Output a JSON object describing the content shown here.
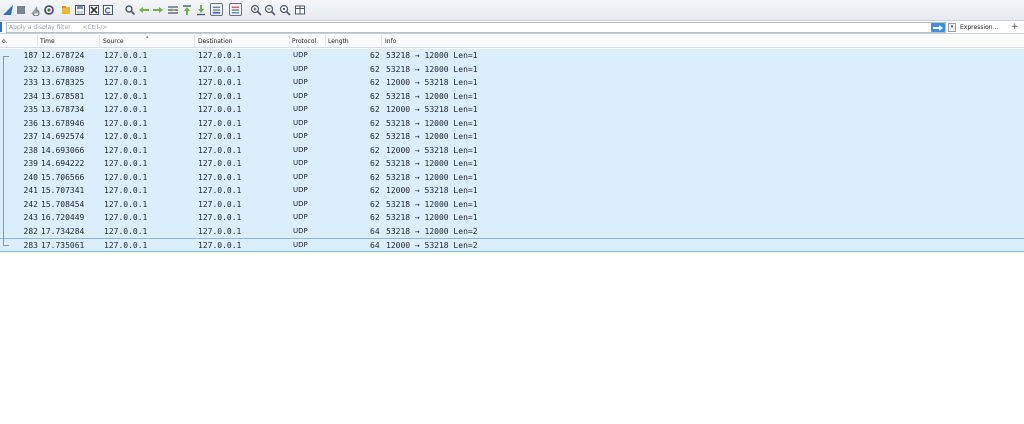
{
  "toolbar": {
    "icons": [
      "shark-fin-start-icon",
      "stop-capture-icon",
      "restart-capture-icon",
      "capture-options-icon",
      "open-file-icon",
      "save-file-icon",
      "close-file-icon",
      "reload-file-icon",
      "find-packet-icon",
      "go-back-icon",
      "go-forward-icon",
      "go-to-packet-icon",
      "go-first-packet-icon",
      "go-last-packet-icon",
      "auto-scroll-icon",
      "colorize-icon",
      "zoom-in-icon",
      "zoom-out-icon",
      "normal-size-icon",
      "resize-columns-icon"
    ],
    "colors": {
      "accent": "#3b6fb6",
      "icon": "#4d5866"
    }
  },
  "filter": {
    "placeholder": "Apply a display filter",
    "shortcut_hint": "<Ctrl-/>",
    "expression_label": "Expression...",
    "add_label": "+",
    "dropdown_label": "▾"
  },
  "columns": {
    "no": "o.",
    "time": "Time",
    "source": "Source",
    "destination": "Destination",
    "protocol": "Protocol",
    "length": "Length",
    "info": "Info"
  },
  "packets": [
    {
      "no": "187",
      "time": "12.678724",
      "src": "127.0.0.1",
      "dst": "127.0.0.1",
      "proto": "UDP",
      "len": "62",
      "info": "53218 → 12000 Len=1"
    },
    {
      "no": "232",
      "time": "13.678089",
      "src": "127.0.0.1",
      "dst": "127.0.0.1",
      "proto": "UDP",
      "len": "62",
      "info": "53218 → 12000 Len=1"
    },
    {
      "no": "233",
      "time": "13.678325",
      "src": "127.0.0.1",
      "dst": "127.0.0.1",
      "proto": "UDP",
      "len": "62",
      "info": "12000 → 53218 Len=1"
    },
    {
      "no": "234",
      "time": "13.678581",
      "src": "127.0.0.1",
      "dst": "127.0.0.1",
      "proto": "UDP",
      "len": "62",
      "info": "53218 → 12000 Len=1"
    },
    {
      "no": "235",
      "time": "13.678734",
      "src": "127.0.0.1",
      "dst": "127.0.0.1",
      "proto": "UDP",
      "len": "62",
      "info": "12000 → 53218 Len=1"
    },
    {
      "no": "236",
      "time": "13.678946",
      "src": "127.0.0.1",
      "dst": "127.0.0.1",
      "proto": "UDP",
      "len": "62",
      "info": "53218 → 12000 Len=1"
    },
    {
      "no": "237",
      "time": "14.692574",
      "src": "127.0.0.1",
      "dst": "127.0.0.1",
      "proto": "UDP",
      "len": "62",
      "info": "53218 → 12000 Len=1"
    },
    {
      "no": "238",
      "time": "14.693066",
      "src": "127.0.0.1",
      "dst": "127.0.0.1",
      "proto": "UDP",
      "len": "62",
      "info": "12000 → 53218 Len=1"
    },
    {
      "no": "239",
      "time": "14.694222",
      "src": "127.0.0.1",
      "dst": "127.0.0.1",
      "proto": "UDP",
      "len": "62",
      "info": "53218 → 12000 Len=1"
    },
    {
      "no": "240",
      "time": "15.706566",
      "src": "127.0.0.1",
      "dst": "127.0.0.1",
      "proto": "UDP",
      "len": "62",
      "info": "53218 → 12000 Len=1"
    },
    {
      "no": "241",
      "time": "15.707341",
      "src": "127.0.0.1",
      "dst": "127.0.0.1",
      "proto": "UDP",
      "len": "62",
      "info": "12000 → 53218 Len=1"
    },
    {
      "no": "242",
      "time": "15.708454",
      "src": "127.0.0.1",
      "dst": "127.0.0.1",
      "proto": "UDP",
      "len": "62",
      "info": "53218 → 12000 Len=1"
    },
    {
      "no": "243",
      "time": "16.720449",
      "src": "127.0.0.1",
      "dst": "127.0.0.1",
      "proto": "UDP",
      "len": "62",
      "info": "53218 → 12000 Len=1"
    },
    {
      "no": "282",
      "time": "17.734284",
      "src": "127.0.0.1",
      "dst": "127.0.0.1",
      "proto": "UDP",
      "len": "64",
      "info": "53218 → 12000 Len=2"
    },
    {
      "no": "283",
      "time": "17.735061",
      "src": "127.0.0.1",
      "dst": "127.0.0.1",
      "proto": "UDP",
      "len": "64",
      "info": "12000 → 53218 Len=2"
    }
  ]
}
